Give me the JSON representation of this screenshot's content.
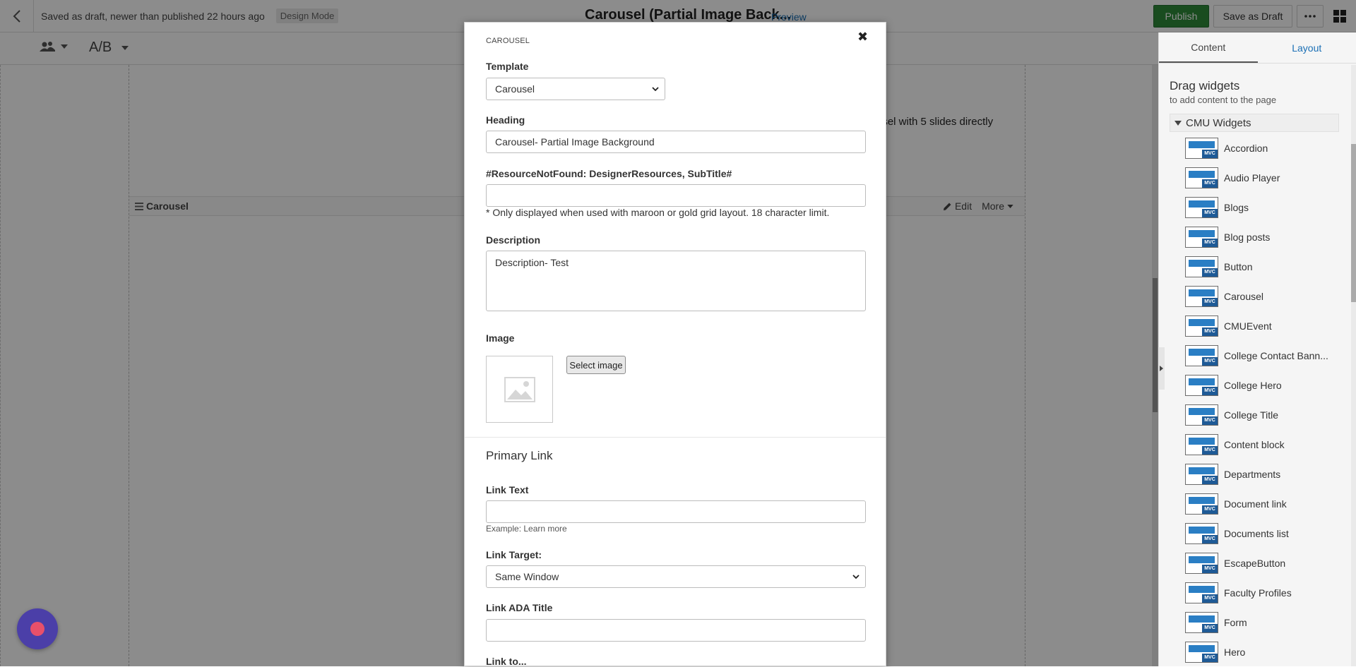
{
  "topbar": {
    "status": "Saved as draft, newer than published 22 hours ago",
    "mode": "Design Mode",
    "title": "Carousel (Partial Image Back...",
    "preview": "Preview",
    "publish": "Publish",
    "save_draft": "Save as Draft",
    "more": "···"
  },
  "toolbar2": {
    "ab": "A/B"
  },
  "canvas": {
    "snippet": "usel with 5 slides directly",
    "widget_title": "Carousel",
    "edit": "Edit",
    "more": "More"
  },
  "modal": {
    "caption": "CAROUSEL",
    "close": "✖",
    "template_label": "Template",
    "template_value": "Carousel",
    "heading_label": "Heading",
    "heading_value": "Carousel- Partial Image Background",
    "subtitle_label": "#ResourceNotFound: DesignerResources, SubTitle#",
    "subtitle_value": "",
    "subtitle_hint": "* Only displayed when used with maroon or gold grid layout. 18 character limit.",
    "description_label": "Description",
    "description_value": "Description- Test",
    "image_label": "Image",
    "select_image": "Select image",
    "primary_link_title": "Primary Link",
    "link_text_label": "Link Text",
    "link_text_value": "",
    "link_text_example": "Example: Learn more",
    "link_target_label": "Link Target:",
    "link_target_value": "Same Window",
    "link_ada_label": "Link ADA Title",
    "link_ada_value": "",
    "link_to_label": "Link to..."
  },
  "panel": {
    "tabs": [
      "Content",
      "Layout"
    ],
    "title": "Drag widgets",
    "subtitle": "to add content to the page",
    "group": "CMU Widgets",
    "mvc": "MVC",
    "widgets": [
      "Accordion",
      "Audio Player",
      "Blogs",
      "Blog posts",
      "Button",
      "Carousel",
      "CMUEvent",
      "College Contact Bann...",
      "College Hero",
      "College Title",
      "Content block",
      "Departments",
      "Document link",
      "Documents list",
      "EscapeButton",
      "Faculty Profiles",
      "Form",
      "Hero"
    ]
  },
  "colors": {
    "publish": "#2e8b3a",
    "accent": "#1a6fb5",
    "mvc_badge": "#1e5a96",
    "fab": "#4b3fa8"
  }
}
